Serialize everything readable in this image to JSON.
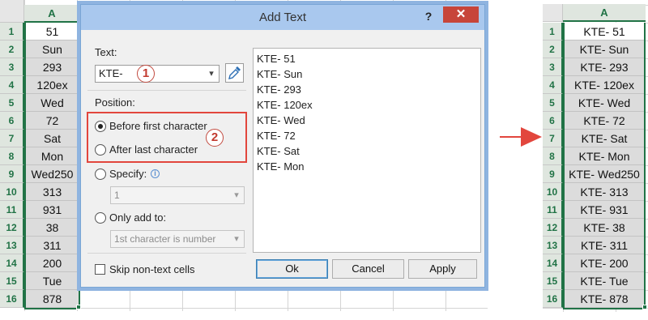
{
  "left_sheet": {
    "column_header": "A",
    "row_numbers": [
      "1",
      "2",
      "3",
      "4",
      "5",
      "6",
      "7",
      "8",
      "9",
      "10",
      "11",
      "12",
      "13",
      "14",
      "15",
      "16"
    ],
    "cells": [
      "51",
      "Sun",
      "293",
      "120ex",
      "Wed",
      "72",
      "Sat",
      "Mon",
      "Wed250",
      "313",
      "931",
      "38",
      "311",
      "200",
      "Tue",
      "878"
    ]
  },
  "dialog": {
    "title": "Add Text",
    "help_label": "?",
    "close_label": "✕",
    "text_label": "Text:",
    "text_value": "KTE-",
    "callout_1": "1",
    "callout_2": "2",
    "position_label": "Position:",
    "before_first": "Before first character",
    "after_last": "After last character",
    "specify_label": "Specify:",
    "specify_value": "1",
    "only_add_label": "Only add to:",
    "only_add_value": "1st character is number",
    "skip_label": "Skip non-text cells",
    "selected_position": "before_first",
    "preview": [
      "KTE- 51",
      "KTE- Sun",
      "KTE- 293",
      "KTE- 120ex",
      "KTE- Wed",
      "KTE- 72",
      "KTE- Sat",
      "KTE- Mon"
    ],
    "ok_label": "Ok",
    "cancel_label": "Cancel",
    "apply_label": "Apply"
  },
  "right_sheet": {
    "column_header": "A",
    "row_numbers": [
      "1",
      "2",
      "3",
      "4",
      "5",
      "6",
      "7",
      "8",
      "9",
      "10",
      "11",
      "12",
      "13",
      "14",
      "15",
      "16"
    ],
    "cells": [
      "KTE- 51",
      "KTE- Sun",
      "KTE- 293",
      "KTE- 120ex",
      "KTE- Wed",
      "KTE- 72",
      "KTE- Sat",
      "KTE- Mon",
      "KTE- Wed250",
      "KTE- 313",
      "KTE- 931",
      "KTE- 38",
      "KTE- 311",
      "KTE- 200",
      "KTE- Tue",
      "KTE- 878"
    ]
  },
  "colors": {
    "excel_green": "#217346",
    "highlight_red": "#e2463d",
    "titlebar": "#a9c8ee",
    "close_red": "#c7453a"
  },
  "icons": [
    "eyedropper-icon",
    "info-icon",
    "chevron-down-icon",
    "close-icon",
    "help-icon",
    "arrow-right-icon"
  ]
}
